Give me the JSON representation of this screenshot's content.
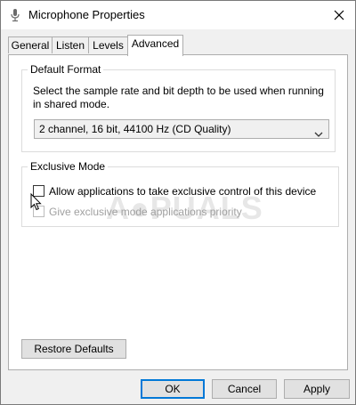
{
  "window": {
    "title": "Microphone Properties"
  },
  "tabs": [
    {
      "label": "General",
      "active": false
    },
    {
      "label": "Listen",
      "active": false
    },
    {
      "label": "Levels",
      "active": false
    },
    {
      "label": "Advanced",
      "active": true
    }
  ],
  "default_format": {
    "legend": "Default Format",
    "description": "Select the sample rate and bit depth to be used when running in shared mode.",
    "selected": "2 channel, 16 bit, 44100 Hz (CD Quality)"
  },
  "exclusive_mode": {
    "legend": "Exclusive Mode",
    "allow_label": "Allow applications to take exclusive control of this device",
    "allow_checked": false,
    "priority_label": "Give exclusive mode applications priority",
    "priority_checked": false,
    "priority_enabled": false
  },
  "buttons": {
    "restore": "Restore Defaults",
    "ok": "OK",
    "cancel": "Cancel",
    "apply": "Apply"
  },
  "watermark": {
    "text": "APPUALS"
  },
  "icons": {
    "window": "microphone-icon",
    "close": "close-icon",
    "chevron": "chevron-down-icon",
    "cursor": "mouse-cursor-icon"
  }
}
